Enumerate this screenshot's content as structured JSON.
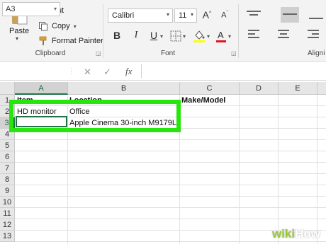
{
  "clipboard": {
    "paste_label": "Paste",
    "cut_label": "Cut",
    "copy_label": "Copy",
    "format_painter_label": "Format Painter",
    "group_label": "Clipboard"
  },
  "font": {
    "name": "Calibri",
    "size": "11",
    "group_label": "Font",
    "bold": "B",
    "italic": "I",
    "underline": "U"
  },
  "alignment": {
    "group_label": "Aligni"
  },
  "formula_bar": {
    "name_box": "A3",
    "fx_label": "fx",
    "value": ""
  },
  "sheet": {
    "columns": [
      "A",
      "B",
      "C",
      "D",
      "E"
    ],
    "rows": [
      "1",
      "2",
      "3",
      "4",
      "5",
      "6",
      "7",
      "8",
      "9",
      "10",
      "11",
      "12",
      "13"
    ],
    "active_column": "A",
    "active_row": "3",
    "cells": {
      "A1": "Item",
      "B1": "Location",
      "C1": "Make/Model",
      "A2": "HD monitor",
      "B2": "Office",
      "B3": "Apple Cinema 30-inch M9179LL"
    }
  },
  "watermark": {
    "wiki": "wiki",
    "how": "How"
  },
  "colors": {
    "excel_green": "#217346",
    "highlight_green": "#27e60d",
    "font_color_red": "#e81123",
    "fill_yellow": "#ffff00"
  }
}
